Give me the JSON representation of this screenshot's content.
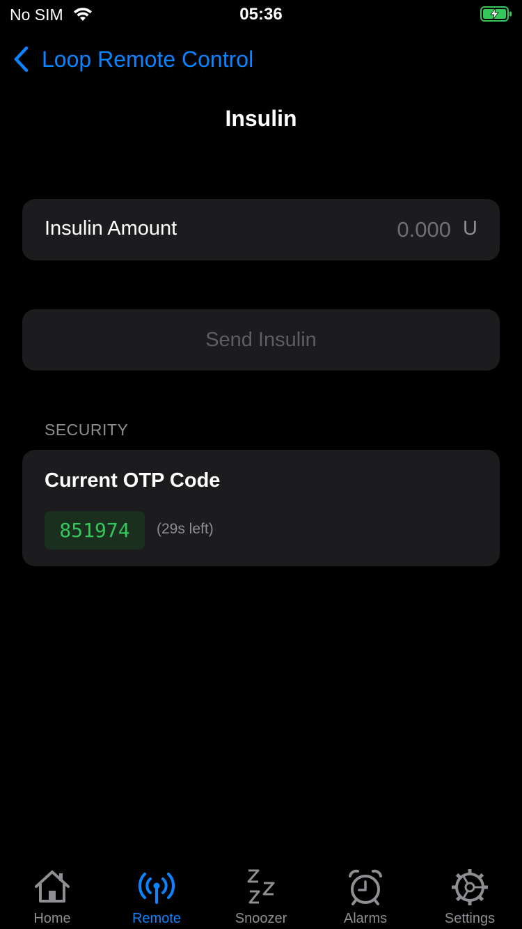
{
  "status_bar": {
    "carrier": "No SIM",
    "time": "05:36"
  },
  "nav": {
    "back_label": "Loop Remote Control",
    "title": "Insulin"
  },
  "insulin_amount": {
    "label": "Insulin Amount",
    "value": "0.000",
    "unit": "U"
  },
  "send_button": {
    "label": "Send Insulin"
  },
  "security": {
    "header": "SECURITY",
    "title": "Current OTP Code",
    "code": "851974",
    "remaining": "(29s left)"
  },
  "tabs": [
    {
      "label": "Home",
      "icon": "home-icon",
      "active": false
    },
    {
      "label": "Remote",
      "icon": "antenna-icon",
      "active": true
    },
    {
      "label": "Snoozer",
      "icon": "zzz-icon",
      "active": false
    },
    {
      "label": "Alarms",
      "icon": "alarm-clock-icon",
      "active": false
    },
    {
      "label": "Settings",
      "icon": "gear-icon",
      "active": false
    }
  ],
  "colors": {
    "accent": "#0a84ff",
    "otp_green": "#34c759",
    "battery_green": "#34c759"
  }
}
